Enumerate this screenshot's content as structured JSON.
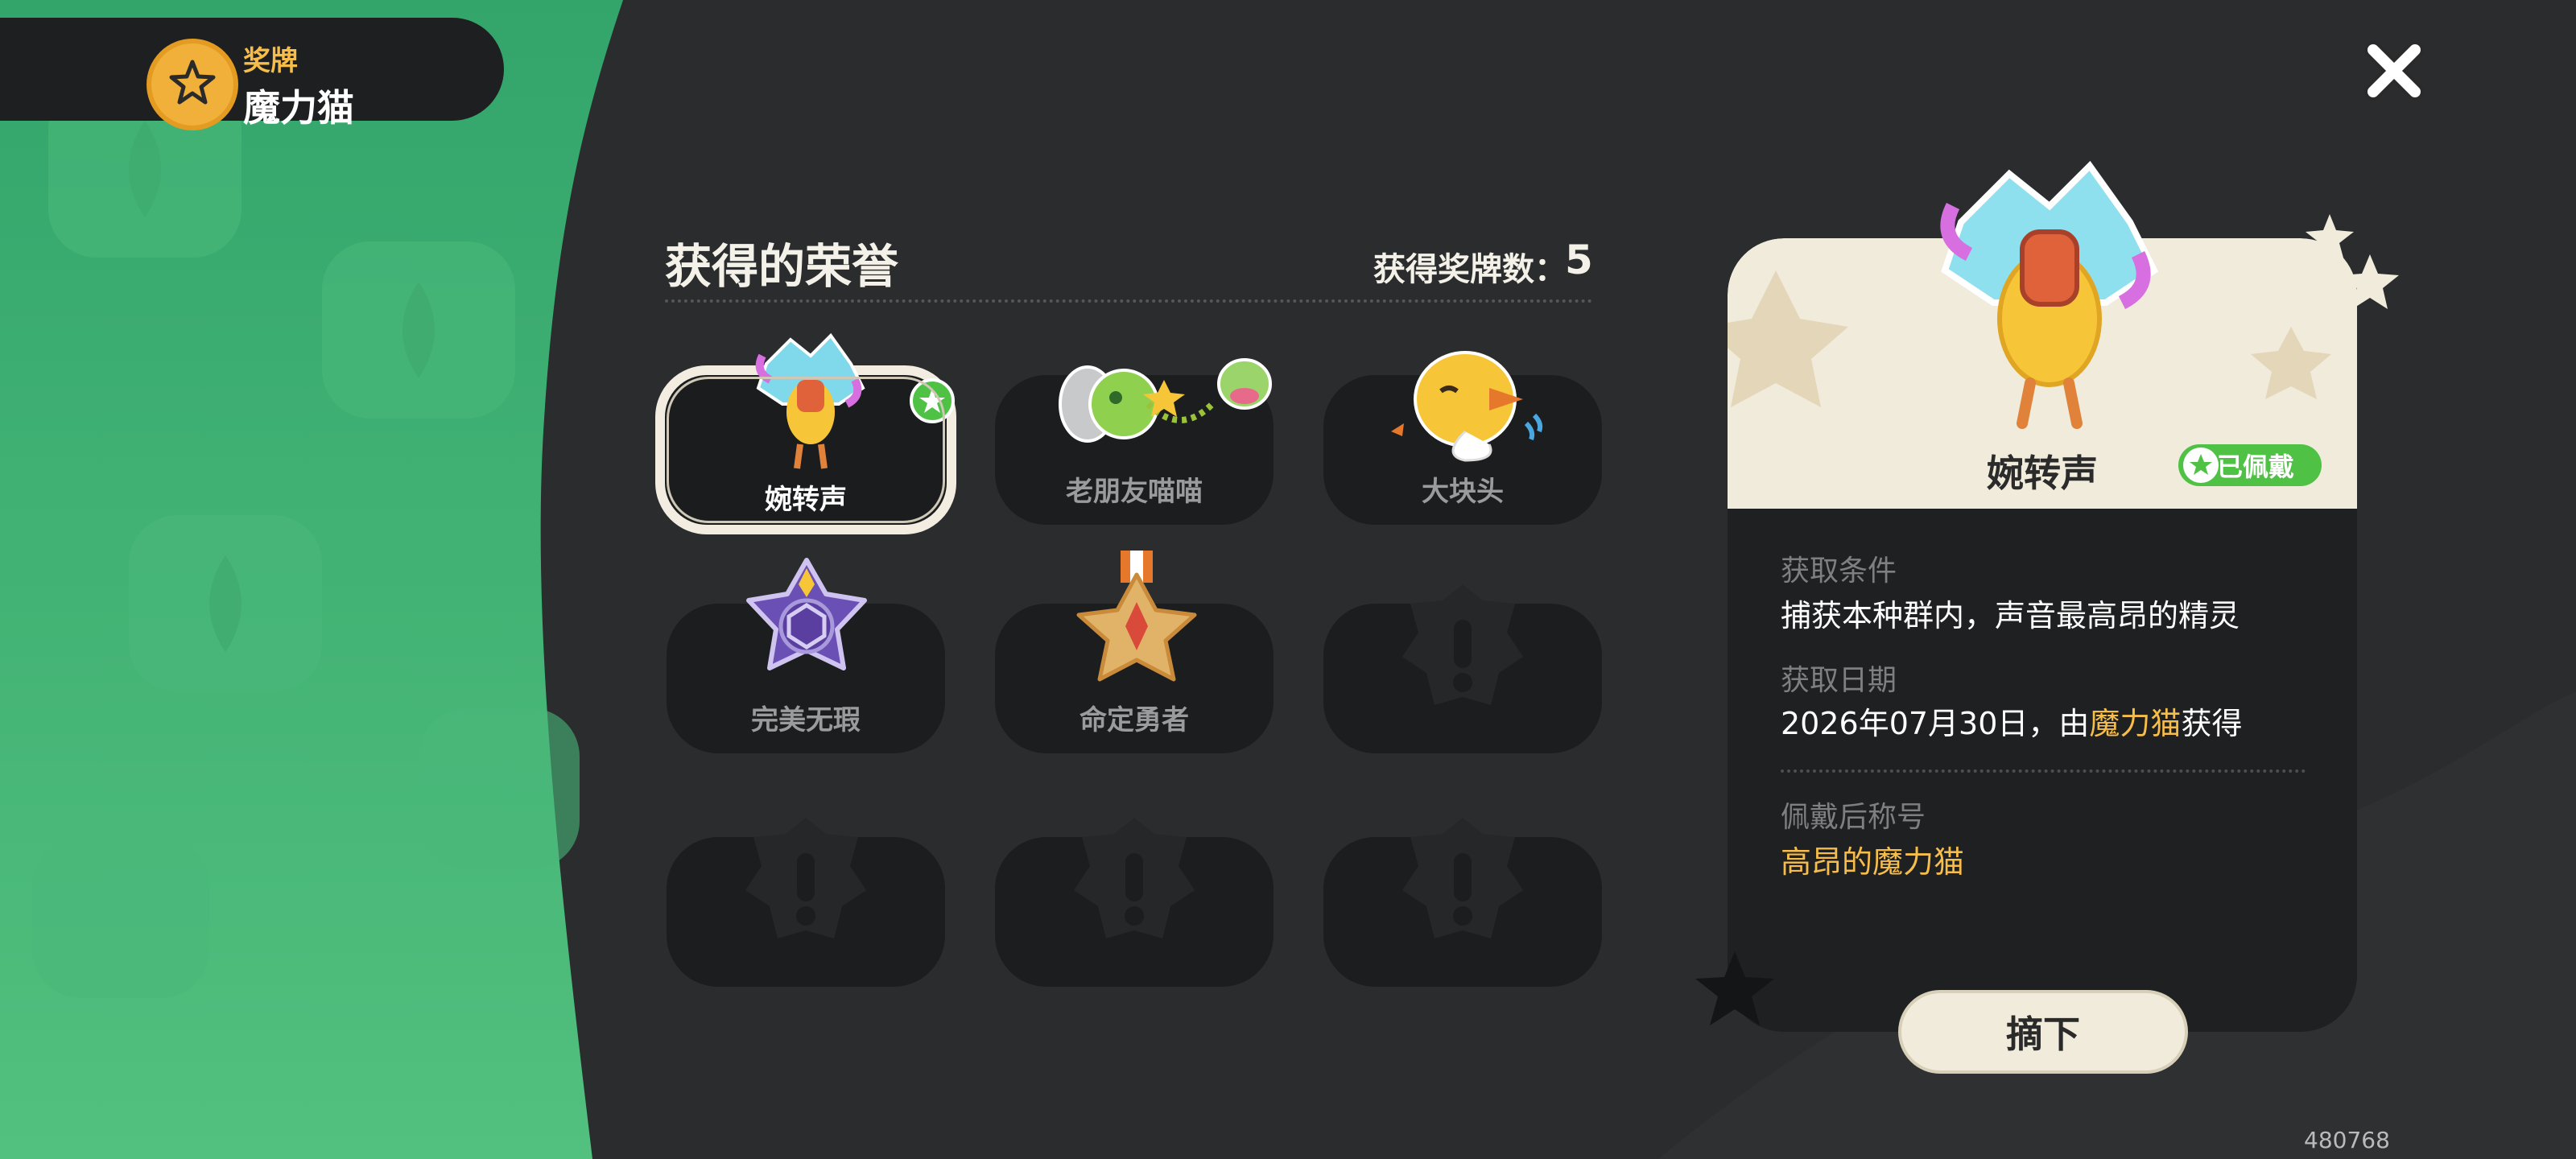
{
  "header": {
    "category": "奖牌",
    "name": "魔力猫"
  },
  "honors": {
    "title": "获得的荣誉",
    "count_label": "获得奖牌数：",
    "count_value": "5"
  },
  "medals": [
    {
      "name": "婉转声",
      "selected": true,
      "icon": "singing-duck-medal-icon"
    },
    {
      "name": "老朋友喵喵",
      "selected": false,
      "icon": "old-friend-meow-medal-icon"
    },
    {
      "name": "大块头",
      "selected": false,
      "icon": "big-guy-medal-icon"
    },
    {
      "name": "完美无瑕",
      "selected": false,
      "icon": "purple-star-medal-icon"
    },
    {
      "name": "命定勇者",
      "selected": false,
      "icon": "gold-star-medal-icon"
    },
    {
      "name": "",
      "locked": true,
      "icon": "locked-medal-icon"
    },
    {
      "name": "",
      "locked": true,
      "icon": "locked-medal-icon"
    },
    {
      "name": "",
      "locked": true,
      "icon": "locked-medal-icon"
    },
    {
      "name": "",
      "locked": true,
      "icon": "locked-medal-icon"
    }
  ],
  "detail": {
    "name": "婉转声",
    "equipped_badge": "已佩戴",
    "condition_label": "获取条件",
    "condition_text": "捕获本种群内，声音最高昂的精灵",
    "date_label": "获取日期",
    "date_prefix": "2026年07月30日，由",
    "date_owner": "魔力猫",
    "date_suffix": "获得",
    "title_label": "佩戴后称号",
    "title_text": "高昂的魔力猫"
  },
  "remove_button": "摘下",
  "user_id": "480768",
  "colors": {
    "accent_yellow": "#f6bd4a",
    "green_bg": "#3fb575",
    "equipped_green": "#4fc245"
  }
}
